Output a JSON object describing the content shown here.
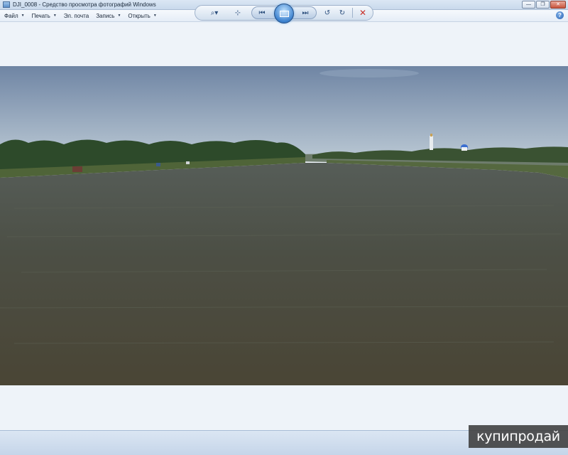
{
  "window": {
    "title": "DJI_0008 - Средство просмотра фотографий Windows"
  },
  "menubar": {
    "items": [
      {
        "label": "Файл",
        "has_dropdown": true
      },
      {
        "label": "Печать",
        "has_dropdown": true
      },
      {
        "label": "Эл. почта",
        "has_dropdown": false
      },
      {
        "label": "Запись",
        "has_dropdown": true
      },
      {
        "label": "Открыть",
        "has_dropdown": true
      }
    ],
    "help_icon": "help-icon"
  },
  "photo": {
    "subject": "aerial-river-landscape",
    "colors": {
      "sky_top": "#6f85a4",
      "sky_bottom": "#b7c6d3",
      "water": "#4a4c40",
      "trees": "#2f4a2c"
    }
  },
  "controls": {
    "icons": [
      "zoom-icon",
      "actual-size-icon",
      "previous-icon",
      "slideshow-icon",
      "next-icon",
      "rotate-left-icon",
      "rotate-right-icon",
      "delete-icon"
    ]
  },
  "watermark": {
    "text": "купипродай"
  }
}
